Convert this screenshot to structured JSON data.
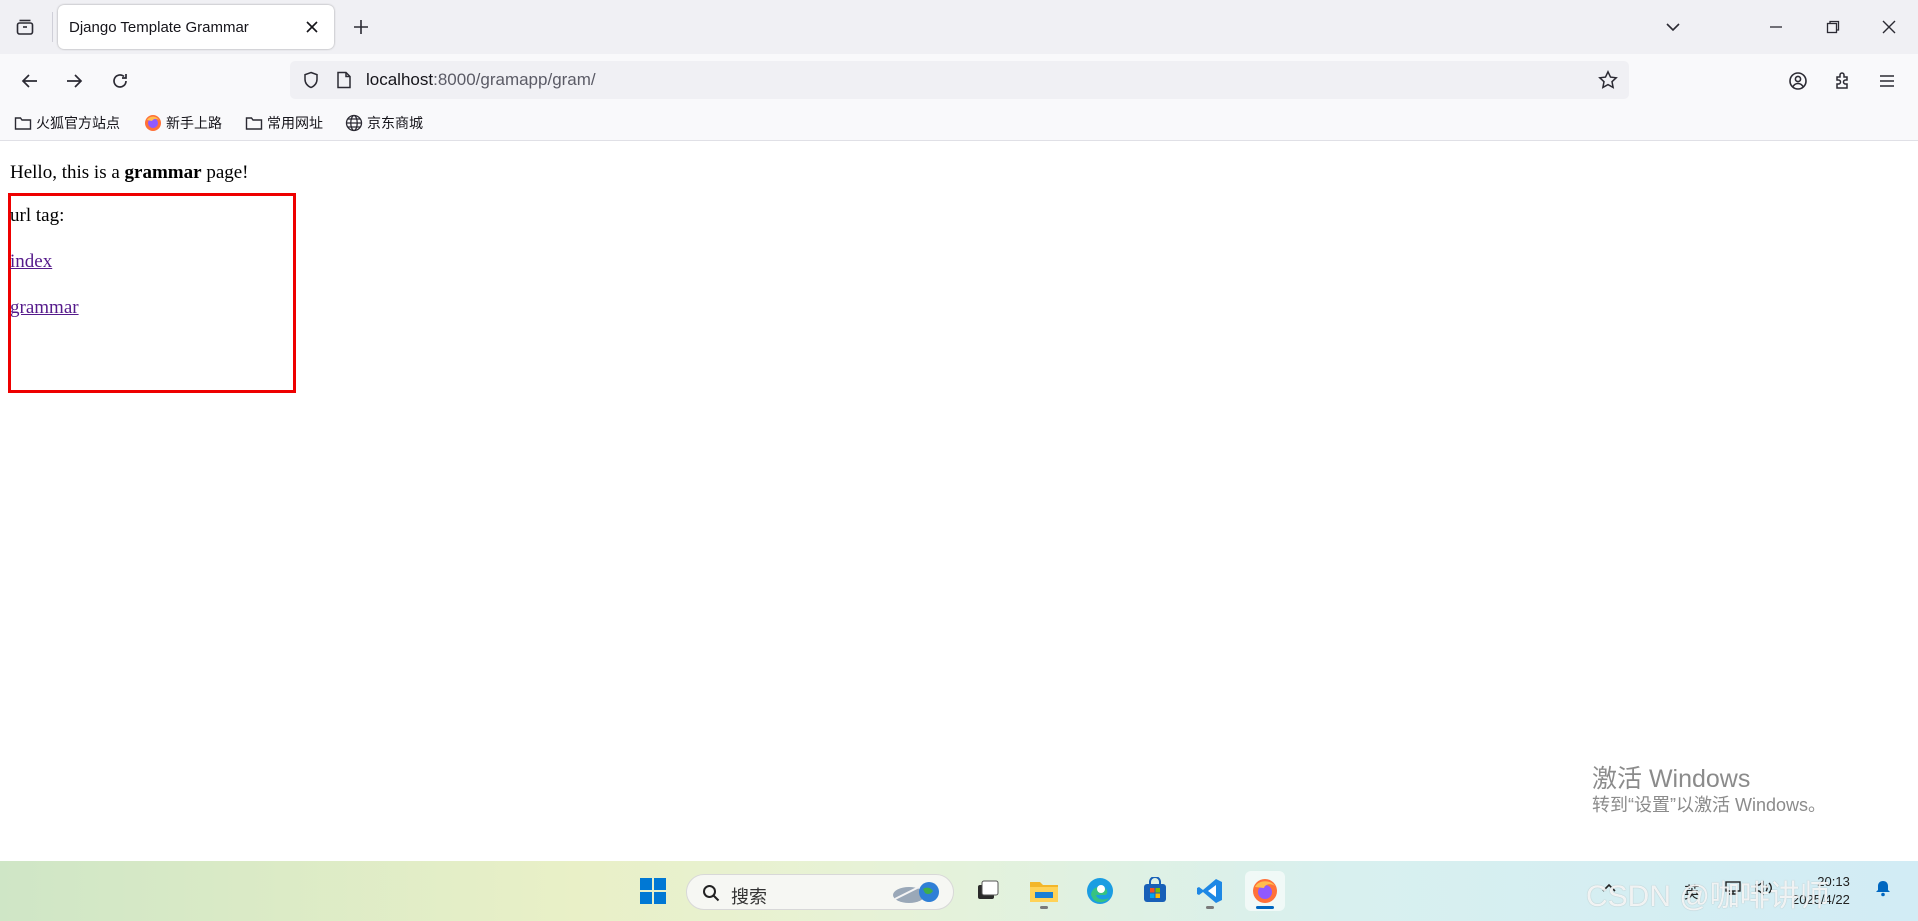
{
  "browser": {
    "tab": {
      "title": "Django Template Grammar"
    },
    "url": {
      "host": "localhost",
      "rest": ":8000/gramapp/gram/"
    },
    "bookmarks": [
      {
        "label": "火狐官方站点",
        "icon": "folder-icon"
      },
      {
        "label": "新手上路",
        "icon": "firefox-icon"
      },
      {
        "label": "常用网址",
        "icon": "folder-icon"
      },
      {
        "label": "京东商城",
        "icon": "globe-icon"
      }
    ]
  },
  "page": {
    "hello_prefix": "Hello, this is a ",
    "hello_bold": "grammar",
    "hello_suffix": " page!",
    "url_tag_label": "url tag:",
    "links": [
      "index",
      "grammar"
    ],
    "highlight_color": "#ee0000"
  },
  "watermark": {
    "title": "激活 Windows",
    "subtitle": "转到“设置”以激活 Windows。"
  },
  "taskbar": {
    "search_placeholder": "搜索",
    "tray_lang": "英",
    "clock_time": "20:13",
    "clock_date": "2025/4/22",
    "csdn_overlay": "CSDN @咖啡讲师"
  }
}
